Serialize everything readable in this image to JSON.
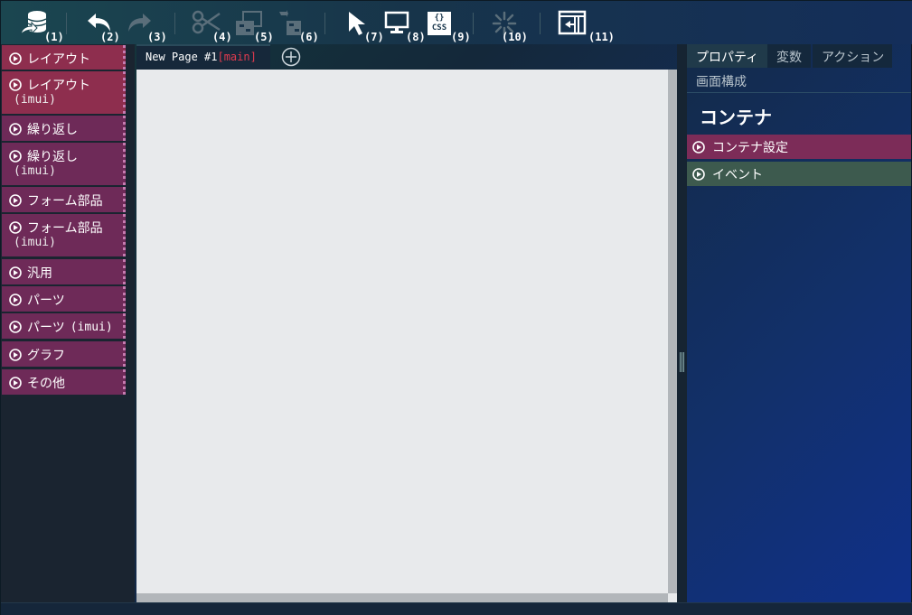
{
  "toolbar": {
    "buttons": [
      {
        "num": "(1)",
        "icon": "database-export-icon"
      },
      {
        "num": "(2)",
        "icon": "undo-icon"
      },
      {
        "num": "(3)",
        "icon": "redo-icon"
      },
      {
        "num": "(4)",
        "icon": "cut-icon"
      },
      {
        "num": "(5)",
        "icon": "copy-icon"
      },
      {
        "num": "(6)",
        "icon": "paste-icon"
      },
      {
        "num": "(7)",
        "icon": "pointer-icon"
      },
      {
        "num": "(8)",
        "icon": "monitor-icon"
      },
      {
        "num": "(9)",
        "icon": "css-icon",
        "glyph_top": "{}",
        "glyph_bottom": "CSS"
      },
      {
        "num": "(10)",
        "icon": "loading-icon"
      },
      {
        "num": "(11)",
        "icon": "panel-toggle-icon"
      }
    ]
  },
  "palette": {
    "items": [
      {
        "label": "レイアウト"
      },
      {
        "label": "レイアウト",
        "sub": "(imui)"
      },
      {
        "label": "繰り返し"
      },
      {
        "label": "繰り返し",
        "sub": "(imui)"
      },
      {
        "label": "フォーム部品"
      },
      {
        "label": "フォーム部品",
        "sub": "(imui)"
      },
      {
        "label": "汎用"
      },
      {
        "label": "パーツ"
      },
      {
        "label": "パーツ",
        "mono": "(imui)"
      },
      {
        "label": "グラフ"
      },
      {
        "label": "その他"
      }
    ]
  },
  "tabs": {
    "page_name": "New Page #1",
    "page_tag": "[main]"
  },
  "right": {
    "tabs": [
      "プロパティ",
      "変数",
      "アクション",
      "画面構成"
    ],
    "heading": "コンテナ",
    "sections": [
      "コンテナ設定",
      "イベント"
    ]
  },
  "colors": {
    "accent_pink": "#7c2c58",
    "accent_green": "#3d5a4e",
    "main_tag": "#e23b4f"
  }
}
